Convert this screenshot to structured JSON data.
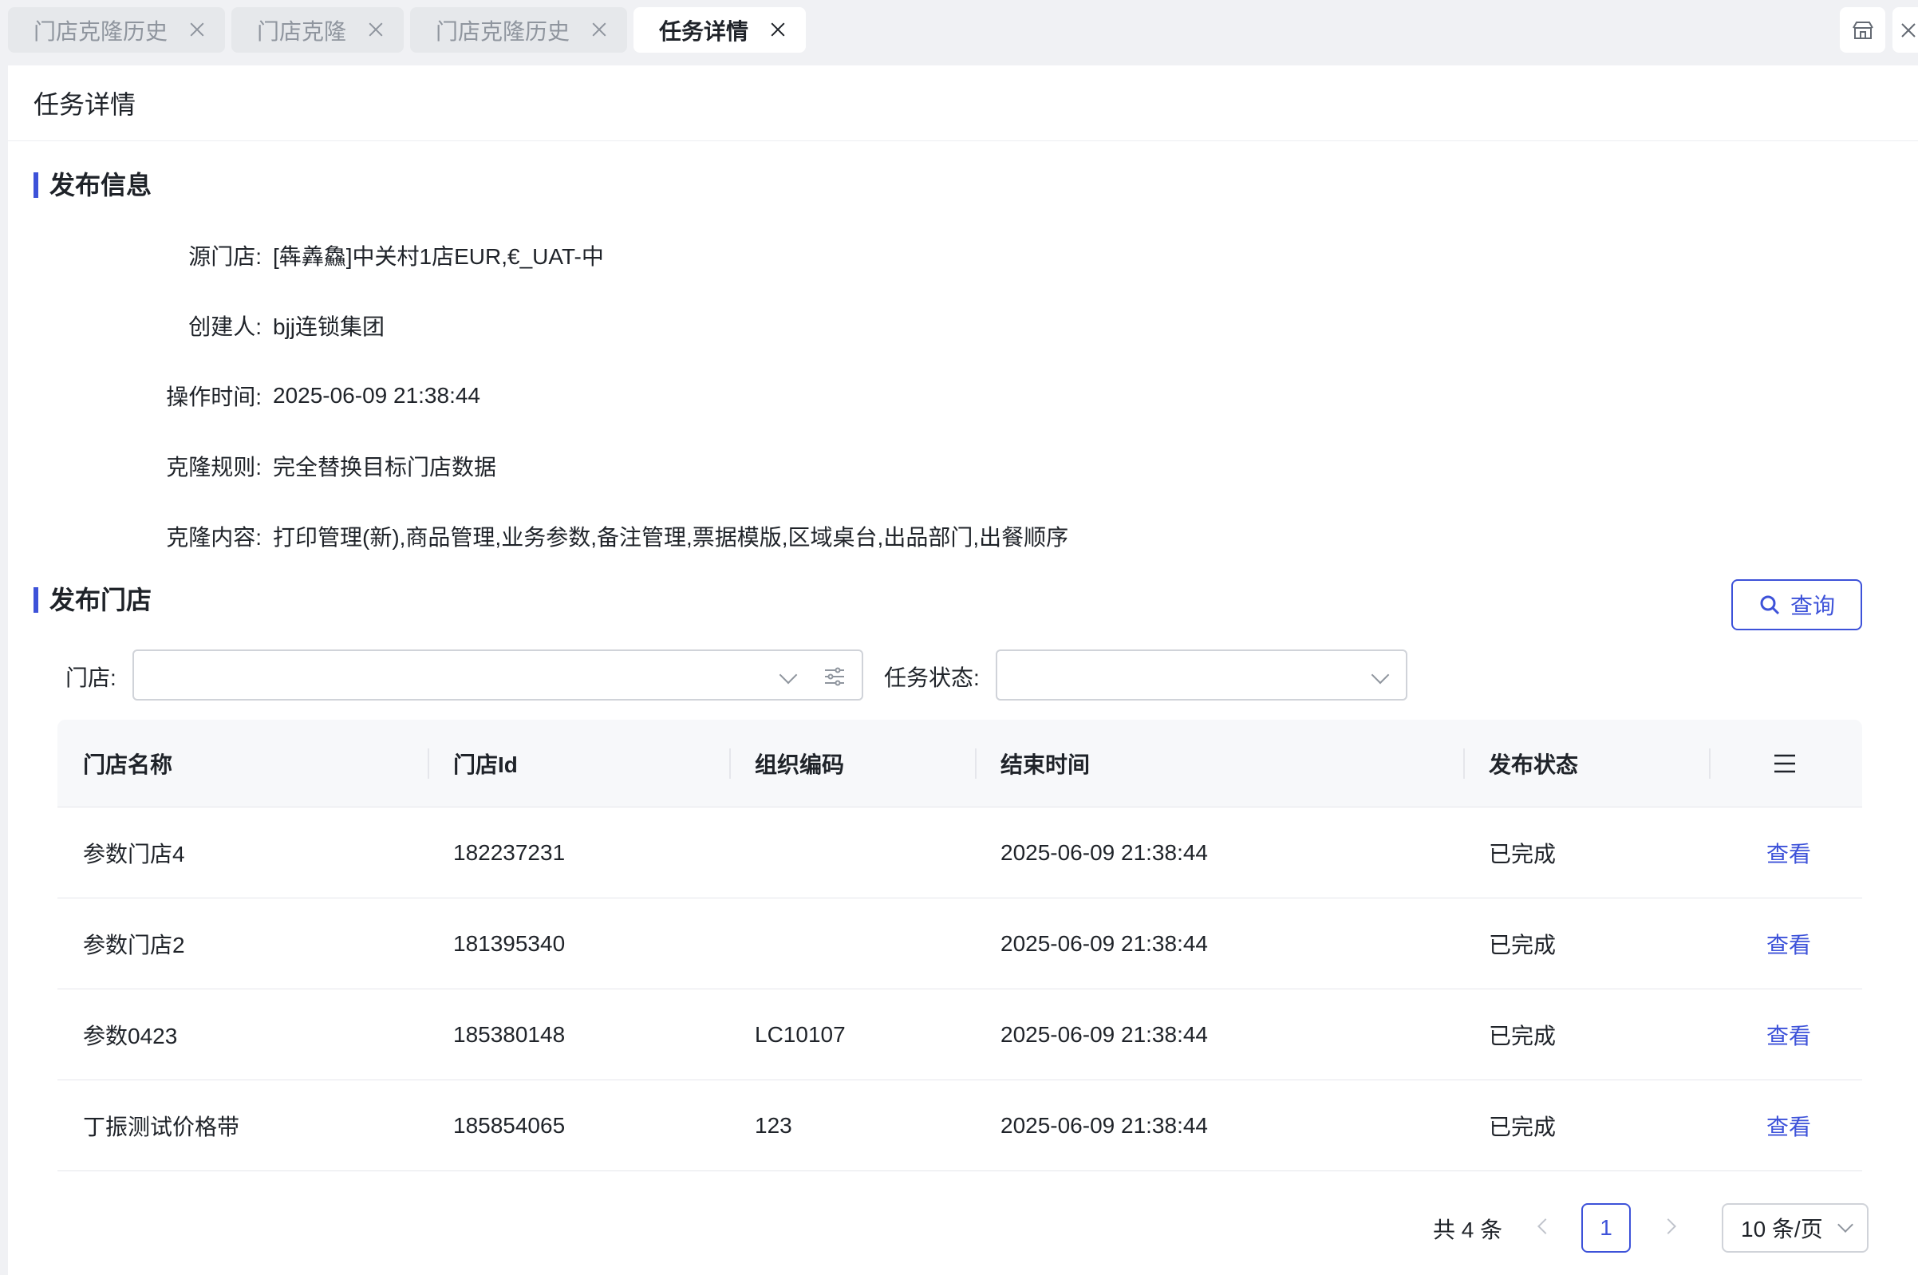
{
  "tabs": [
    {
      "label": "门店克隆历史",
      "active": false
    },
    {
      "label": "门店克隆",
      "active": false
    },
    {
      "label": "门店克隆历史",
      "active": false
    },
    {
      "label": "任务详情",
      "active": true
    }
  ],
  "page_title": "任务详情",
  "publish_info": {
    "heading": "发布信息",
    "rows": [
      {
        "label": "源门店:",
        "value": "[犇羴鱻]中关村1店EUR,€_UAT-中"
      },
      {
        "label": "创建人:",
        "value": "bjj连锁集团"
      },
      {
        "label": "操作时间:",
        "value": "2025-06-09 21:38:44"
      },
      {
        "label": "克隆规则:",
        "value": "完全替换目标门店数据"
      },
      {
        "label": "克隆内容:",
        "value": "打印管理(新),商品管理,业务参数,备注管理,票据模版,区域桌台,出品部门,出餐顺序"
      }
    ]
  },
  "publish_stores": {
    "heading": "发布门店",
    "filters": {
      "store_label": "门店:",
      "store_value": "",
      "status_label": "任务状态:",
      "status_value": ""
    },
    "query_label": "查询",
    "columns": [
      "门店名称",
      "门店Id",
      "组织编码",
      "结束时间",
      "发布状态"
    ],
    "rows": [
      {
        "name": "参数门店4",
        "id": "182237231",
        "org_code": "",
        "end_time": "2025-06-09 21:38:44",
        "status": "已完成",
        "action": "查看"
      },
      {
        "name": "参数门店2",
        "id": "181395340",
        "org_code": "",
        "end_time": "2025-06-09 21:38:44",
        "status": "已完成",
        "action": "查看"
      },
      {
        "name": "参数0423",
        "id": "185380148",
        "org_code": "LC10107",
        "end_time": "2025-06-09 21:38:44",
        "status": "已完成",
        "action": "查看"
      },
      {
        "name": "丁振测试价格带",
        "id": "185854065",
        "org_code": "123",
        "end_time": "2025-06-09 21:38:44",
        "status": "已完成",
        "action": "查看"
      }
    ]
  },
  "pagination": {
    "total_text": "共 4 条",
    "current_page": "1",
    "page_size": "10 条/页"
  },
  "icons": {
    "search": "search-icon",
    "column_menu": "menu-icon",
    "close": "close-icon"
  },
  "colors": {
    "accent": "#3d52d9",
    "text": "#1f2329",
    "muted": "#8f959e"
  }
}
